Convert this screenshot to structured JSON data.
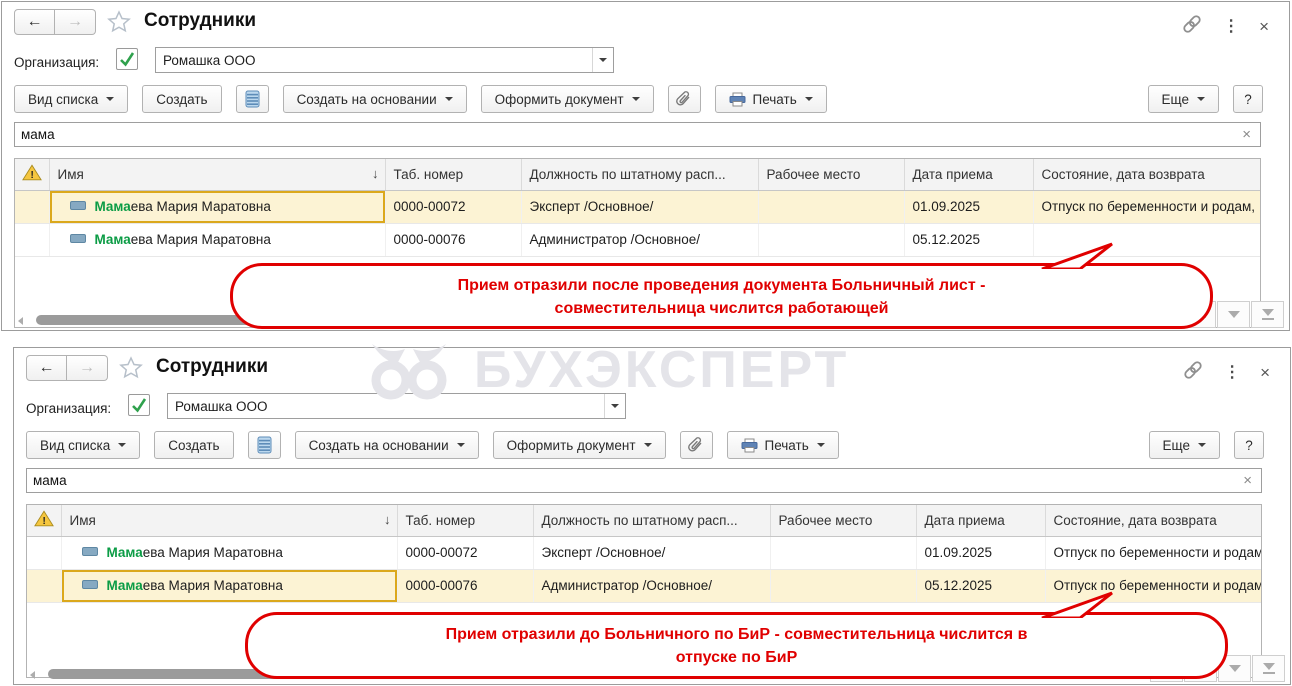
{
  "watermark": {
    "text": "БУХЭКСПЕРТ"
  },
  "icons": {
    "back": {
      "name": "back-arrow",
      "glyph": "←"
    },
    "forward": {
      "name": "forward-arrow",
      "glyph": "→"
    },
    "close": {
      "name": "close-x",
      "glyph": "×"
    },
    "clear": {
      "name": "clear-x",
      "glyph": "×"
    },
    "menu": {
      "name": "vertical-dots",
      "glyph": "⋮"
    },
    "sort": {
      "name": "sort-descending",
      "glyph": "↓"
    },
    "warning": {
      "name": "warning-triangle",
      "glyph": "!"
    },
    "favorite": {
      "name": "star-outline"
    },
    "link": {
      "name": "chain-link"
    },
    "employee": {
      "name": "employee-marker"
    },
    "attachment": {
      "name": "paperclip"
    },
    "print": {
      "name": "printer"
    },
    "create_group": {
      "name": "list-stack"
    }
  },
  "windows": [
    {
      "title": "Сотрудники",
      "org": {
        "label": "Организация:",
        "value": "Ромашка ООО"
      },
      "toolbar": {
        "view_list": "Вид списка",
        "create": "Создать",
        "create_based": "Создать на основании",
        "make_document": "Оформить документ",
        "print": "Печать",
        "more": "Еще",
        "help": "?"
      },
      "search": {
        "value": "мама"
      },
      "table": {
        "columns": {
          "name": "Имя",
          "tab_number": "Таб. номер",
          "position": "Должность по штатному расп...",
          "workplace": "Рабочее место",
          "hire_date": "Дата приема",
          "state": "Состояние, дата возврата"
        },
        "rows": [
          {
            "name_match": "Мама",
            "name_rest": "ева Мария Маратовна",
            "tab_number": "0000-00072",
            "position": "Эксперт /Основное/",
            "workplace": "",
            "hire_date": "01.09.2025",
            "state": "Отпуск по беременности и родам,"
          },
          {
            "name_match": "Мама",
            "name_rest": "ева Мария Маратовна",
            "tab_number": "0000-00076",
            "position": "Администратор /Основное/",
            "workplace": "",
            "hire_date": "05.12.2025",
            "state": ""
          }
        ]
      },
      "callout": {
        "line1": "Прием отразили после проведения документа Больничный лист -",
        "line2": "совместительница числится работающей"
      }
    },
    {
      "title": "Сотрудники",
      "org": {
        "label": "Организация:",
        "value": "Ромашка ООО"
      },
      "toolbar": {
        "view_list": "Вид списка",
        "create": "Создать",
        "create_based": "Создать на основании",
        "make_document": "Оформить документ",
        "print": "Печать",
        "more": "Еще",
        "help": "?"
      },
      "search": {
        "value": "мама"
      },
      "table": {
        "columns": {
          "name": "Имя",
          "tab_number": "Таб. номер",
          "position": "Должность по штатному расп...",
          "workplace": "Рабочее место",
          "hire_date": "Дата приема",
          "state": "Состояние, дата возврата"
        },
        "rows": [
          {
            "name_match": "Мама",
            "name_rest": "ева Мария Маратовна",
            "tab_number": "0000-00072",
            "position": "Эксперт /Основное/",
            "workplace": "",
            "hire_date": "01.09.2025",
            "state": "Отпуск по беременности и родам,"
          },
          {
            "name_match": "Мама",
            "name_rest": "ева Мария Маратовна",
            "tab_number": "0000-00076",
            "position": "Администратор /Основное/",
            "workplace": "",
            "hire_date": "05.12.2025",
            "state": "Отпуск по беременности и родам,"
          }
        ]
      },
      "callout": {
        "line1": "Прием отразили до Больничного по БиР - совместительница числится в",
        "line2": "отпуске по БиР"
      }
    }
  ]
}
